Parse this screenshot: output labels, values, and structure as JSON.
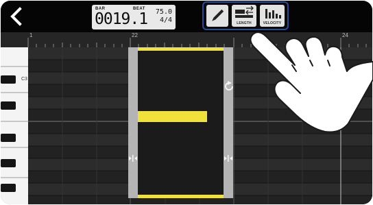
{
  "header": {
    "back_icon": "chevron-left-icon",
    "position": {
      "bar_label": "BAR",
      "beat_label": "BEAT",
      "value": "0019.1"
    },
    "tempo": {
      "bpm": "75.0",
      "time_signature": "4/4"
    },
    "tools": [
      {
        "name": "pencil",
        "icon": "pencil-icon",
        "label": ""
      },
      {
        "name": "length",
        "icon": "length-icon",
        "label": "LENGTH"
      },
      {
        "name": "velocity",
        "icon": "velocity-icon",
        "label": "VELOCITY"
      }
    ],
    "highlight_color": "#2b4a9a"
  },
  "ruler": {
    "labels": [
      "1",
      "22",
      "24"
    ]
  },
  "piano": {
    "octave_label": "C3"
  },
  "editor": {
    "note_color": "#f0e23a",
    "selection_color": "#b4b4b4",
    "icons": [
      "resize-left-icon",
      "resize-right-icon",
      "loop-icon"
    ]
  },
  "overlay": {
    "hand_icon": "pointing-hand-icon"
  }
}
